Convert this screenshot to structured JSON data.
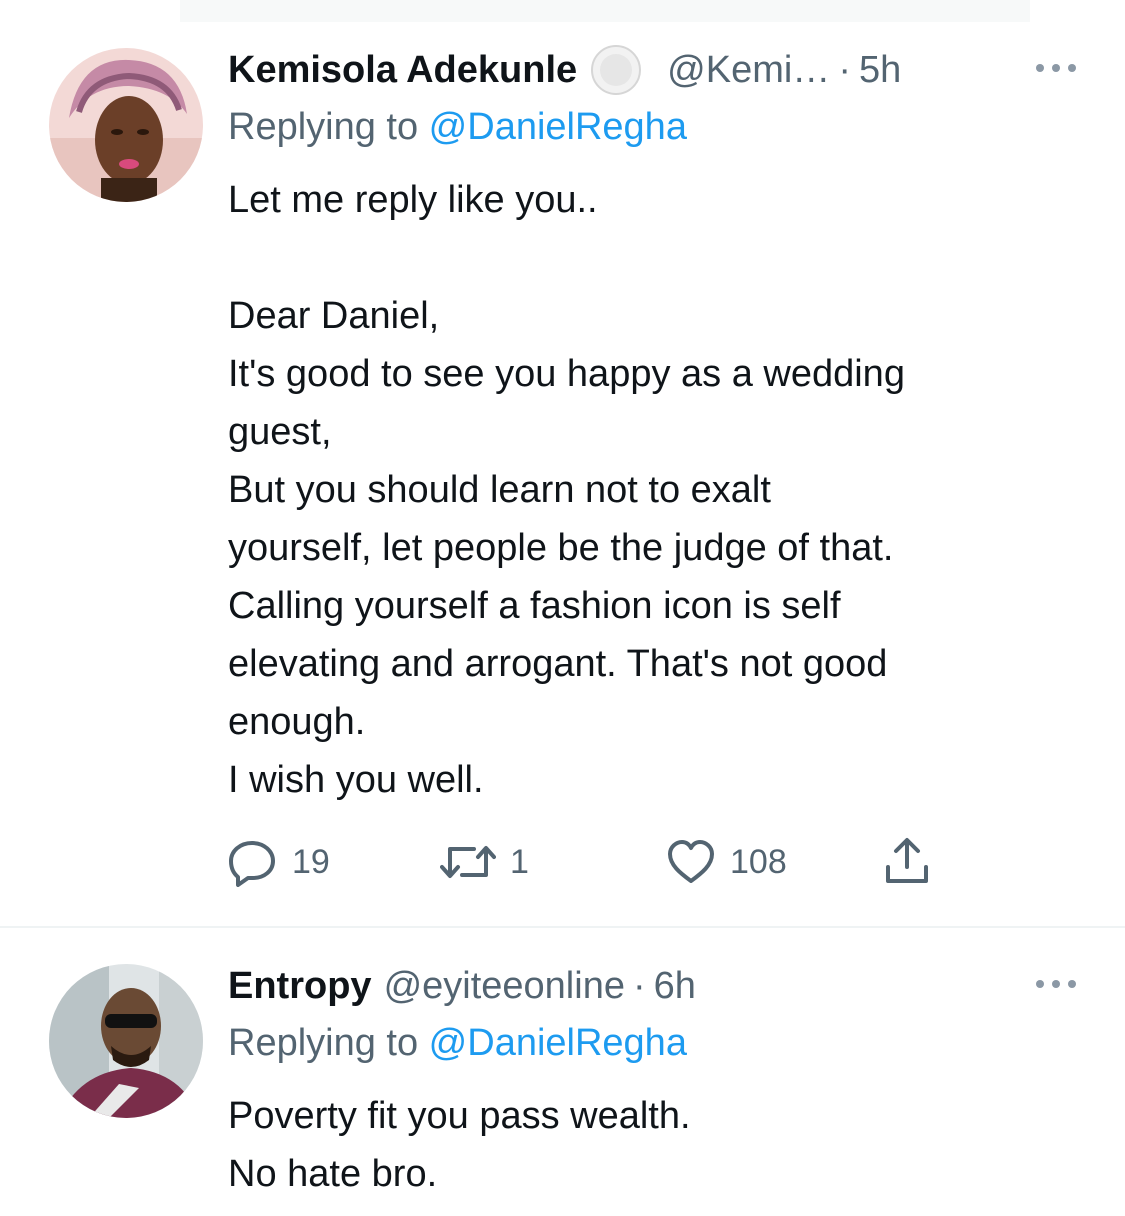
{
  "tweets": [
    {
      "name": "Kemisola Adekunle",
      "handle": "@Kemi…",
      "separator": "·",
      "time": "5h",
      "replying_prefix": "Replying to ",
      "replying_to": "@DanielRegha",
      "lines": [
        "Let me reply like you..",
        "",
        "Dear Daniel,",
        "It's good to see you happy as a wedding",
        "guest,",
        "But you should learn not to exalt",
        "yourself, let people be the judge of that.",
        "Calling yourself a fashion icon is self",
        "elevating and arrogant. That's not good",
        "enough.",
        "I wish you well."
      ],
      "replies": "19",
      "retweets": "1",
      "likes": "108",
      "icons": {
        "verified": "verified-badge-icon",
        "more": "more-options-icon",
        "reply": "reply-icon",
        "retweet": "retweet-icon",
        "like": "heart-icon",
        "share": "share-icon"
      }
    },
    {
      "name": "Entropy",
      "handle": "@eyiteeonline",
      "separator": "·",
      "time": "6h",
      "replying_prefix": "Replying to ",
      "replying_to": "@DanielRegha",
      "lines": [
        "Poverty fit you pass wealth.",
        "No hate bro."
      ]
    }
  ],
  "colors": {
    "text": "#0f1419",
    "secondary": "#536471",
    "link": "#1d9bf0",
    "divider": "#eff3f4"
  }
}
